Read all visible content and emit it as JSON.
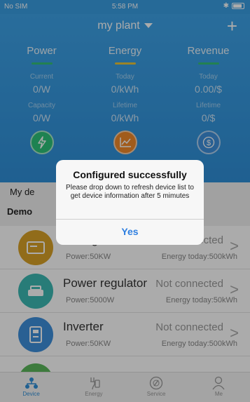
{
  "status_bar": {
    "carrier": "No SIM",
    "time": "5:58 PM"
  },
  "nav": {
    "title": "my plant",
    "add_label": "+"
  },
  "summary": [
    {
      "heading": "Power",
      "accent": "#34c07a",
      "label1": "Current",
      "value1": "0/W",
      "label2": "Capacity",
      "value2": "0/W",
      "icon": "lightning-icon"
    },
    {
      "heading": "Energy",
      "accent": "#e8c33a",
      "label1": "Today",
      "value1": "0/kWh",
      "label2": "Lifetime",
      "value2": "0/kWh",
      "icon": "chart-icon"
    },
    {
      "heading": "Revenue",
      "accent": "#34c07a",
      "label1": "Today",
      "value1": "0.00/$",
      "label2": "Lifetime",
      "value2": "0/$",
      "icon": "dollar-icon"
    }
  ],
  "device_header": {
    "label": "My de",
    "group": "Demo"
  },
  "devices": [
    {
      "name": "Storage",
      "status": "Not connected",
      "power": "Power:50KW",
      "energy": "Energy today:500kWh",
      "color": "#d9a227"
    },
    {
      "name": "Power regulator",
      "status": "Not connected",
      "power": "Power:5000W",
      "energy": "Energy today:50kWh",
      "color": "#3cb9b3"
    },
    {
      "name": "Inverter",
      "status": "Not connected",
      "power": "Power:50KW",
      "energy": "Energy today:500kWh",
      "color": "#3e8fdc"
    }
  ],
  "tabs": [
    {
      "label": "Device",
      "icon": "device-icon",
      "active": true
    },
    {
      "label": "Energy",
      "icon": "energy-icon",
      "active": false
    },
    {
      "label": "Service",
      "icon": "service-icon",
      "active": false
    },
    {
      "label": "Me",
      "icon": "person-icon",
      "active": false
    }
  ],
  "dialog": {
    "title": "Configured successfully",
    "message": "Please drop down  to refresh device list to get device information after 5 mimutes",
    "button": "Yes"
  }
}
